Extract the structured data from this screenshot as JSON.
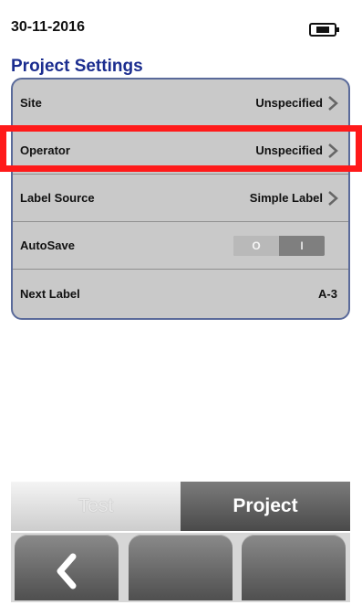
{
  "status": {
    "date": "30-11-2016"
  },
  "page": {
    "title": "Project Settings"
  },
  "settings": {
    "rows": [
      {
        "label": "Site",
        "value": "Unspecified"
      },
      {
        "label": "Operator",
        "value": "Unspecified"
      },
      {
        "label": "Label Source",
        "value": "Simple Label"
      },
      {
        "label": "AutoSave",
        "toggle_off_label": "O",
        "toggle_on_label": "I",
        "state": "off"
      },
      {
        "label": "Next Label",
        "value": "A-3"
      }
    ]
  },
  "tabs": {
    "test": "Test",
    "project": "Project",
    "active": "Project"
  },
  "nav": {
    "icons": [
      "back-icon",
      "",
      ""
    ]
  },
  "colors": {
    "title": "#1b2d8f",
    "highlight": "#ff1a1a",
    "panel": "#c9c9c9",
    "active_tab": "#4a4a4a"
  }
}
